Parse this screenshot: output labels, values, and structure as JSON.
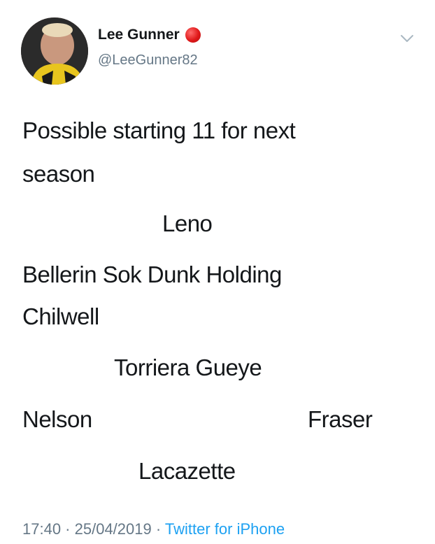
{
  "user": {
    "display_name": "Lee Gunner",
    "handle": "@LeeGunner82",
    "badge_color": "#e0191a"
  },
  "tweet": {
    "lines": [
      "Possible starting 11 for next",
      "season",
      "Leno",
      "Bellerin  Sok Dunk Holding",
      "Chilwell",
      "Torriera Gueye",
      "Nelson",
      "Fraser",
      "Lacazette"
    ]
  },
  "footer": {
    "time": "17:40",
    "separator": " · ",
    "date": "25/04/2019",
    "source": "Twitter for iPhone"
  },
  "colors": {
    "text": "#14171a",
    "secondary": "#657786",
    "link": "#1da1f2"
  },
  "icons": {
    "more": "chevron-down-icon"
  }
}
